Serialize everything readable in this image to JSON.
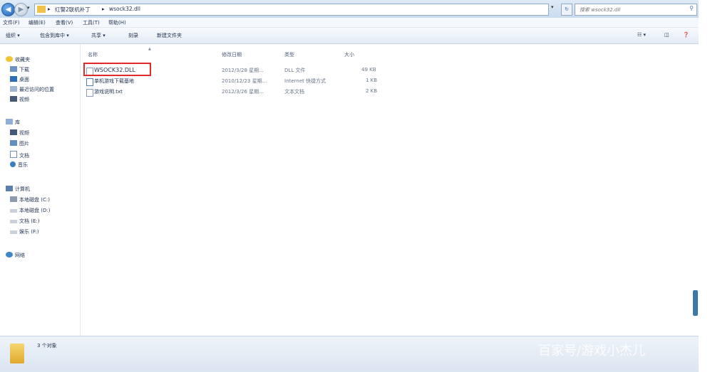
{
  "address": {
    "crumbs": [
      "红警2联机补丁",
      "wsock32.dll"
    ],
    "search_placeholder": "搜索 wsock32.dll"
  },
  "menu": [
    "文件(F)",
    "编辑(E)",
    "查看(V)",
    "工具(T)",
    "帮助(H)"
  ],
  "toolbar": [
    "组织 ▾",
    "包含到库中 ▾",
    "共享 ▾",
    "刻录",
    "新建文件夹"
  ],
  "nav": {
    "favorites": {
      "title": "收藏夹",
      "items": [
        "下载",
        "桌面",
        "最近访问的位置",
        "视频"
      ]
    },
    "libraries": {
      "title": "库",
      "items": [
        "视频",
        "图片",
        "文档",
        "音乐"
      ]
    },
    "computer": {
      "title": "计算机",
      "items": [
        "本地磁盘 (C:)",
        "本地磁盘 (D:)",
        "文档 (E:)",
        "娱乐 (F:)"
      ]
    },
    "network": "网络"
  },
  "columns": [
    "名称",
    "修改日期",
    "类型",
    "大小"
  ],
  "files": [
    {
      "name": "WSOCK32.DLL",
      "date": "2012/3/28 星期...",
      "type": "DLL 文件",
      "size": "49 KB",
      "highlighted": true
    },
    {
      "name": "单机游戏下载基地",
      "date": "2010/12/23 星期...",
      "type": "Internet 快捷方式",
      "size": "1 KB"
    },
    {
      "name": "游戏说明.txt",
      "date": "2012/3/26 星期...",
      "type": "文本文档",
      "size": "2 KB"
    }
  ],
  "status": "3 个对象",
  "watermark": "百家号/游戏小杰儿",
  "colors": {
    "highlight": "#e0292a",
    "chrome": "#dbe5f1"
  }
}
